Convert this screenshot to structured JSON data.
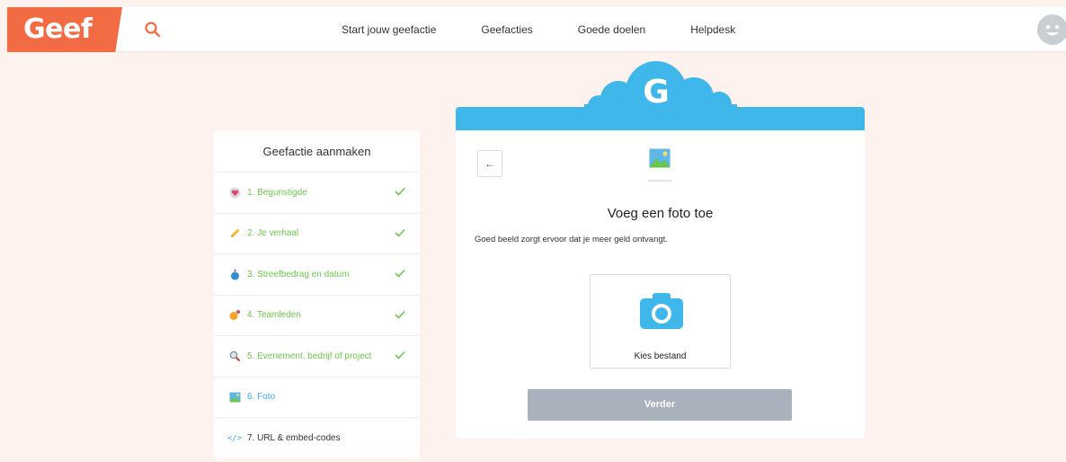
{
  "header": {
    "logo": "Geef",
    "nav": [
      "Start jouw geefactie",
      "Geefacties",
      "Goede doelen",
      "Helpdesk"
    ]
  },
  "sidebar": {
    "title": "Geefactie aanmaken",
    "steps": [
      {
        "label": "1. Begunstigde",
        "icon": "heart-icon",
        "done": true
      },
      {
        "label": "2. Je verhaal",
        "icon": "pencil-icon",
        "done": true
      },
      {
        "label": "3. Streefbedrag en datum",
        "icon": "money-bag-icon",
        "done": true
      },
      {
        "label": "4. Teamleden",
        "icon": "team-icon",
        "done": true
      },
      {
        "label": "5. Evenement, bedrijf of project",
        "icon": "magnifier-icon",
        "done": true
      },
      {
        "label": "6. Foto",
        "icon": "picture-icon",
        "done": false
      },
      {
        "label": "7. URL & embed-codes",
        "icon": "code-icon",
        "done": false
      }
    ]
  },
  "main": {
    "badge_letter": "G",
    "back_label": "←",
    "title": "Voeg een foto toe",
    "description": "Goed beeld zorgt ervoor dat je meer geld ontvangt.",
    "upload_label": "Kies bestand",
    "next_label": "Verder"
  },
  "colors": {
    "brand": "#f26b43",
    "accent": "#3fb7ea",
    "done": "#6cc64a",
    "disabled_button": "#a9b2bc"
  }
}
